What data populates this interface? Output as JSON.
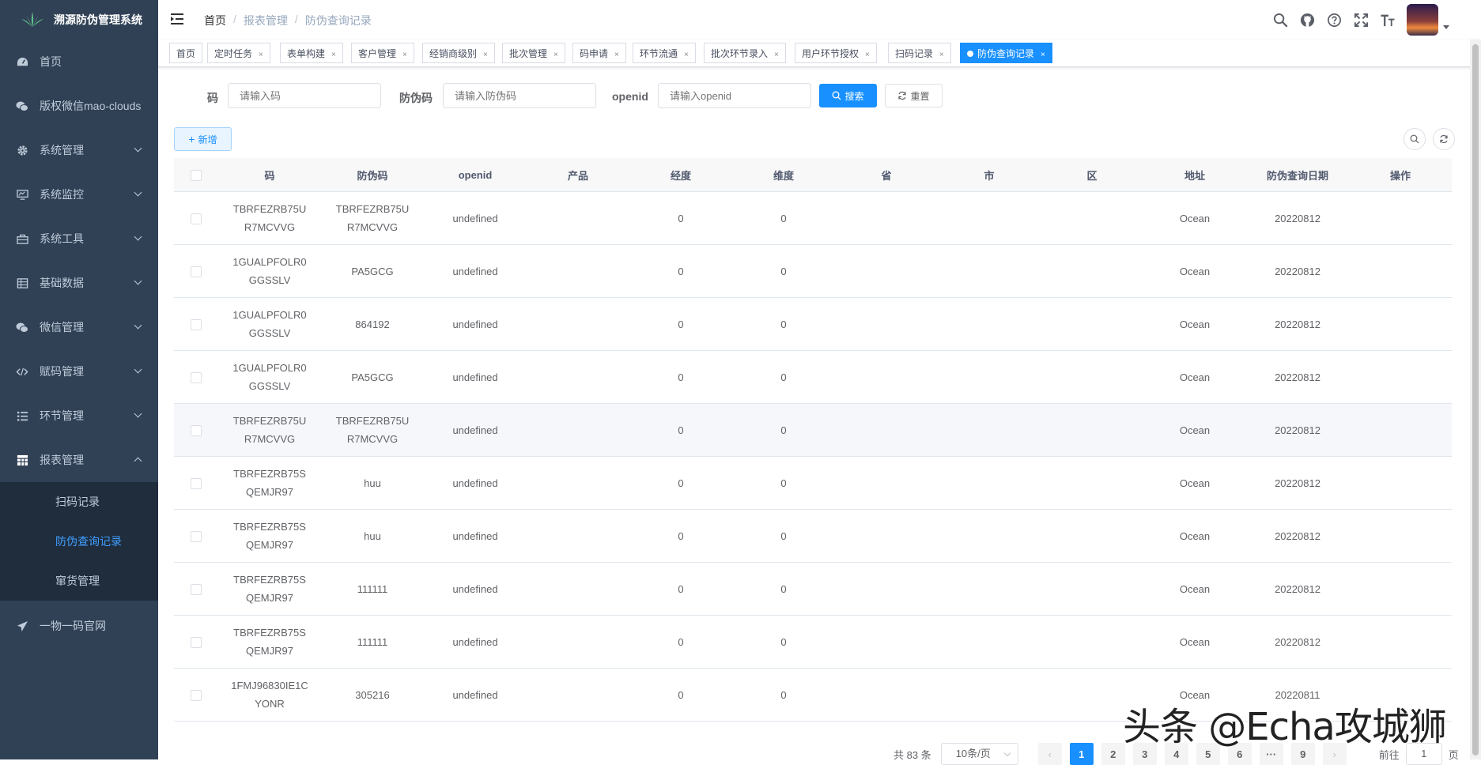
{
  "app": {
    "title": "溯源防伪管理系统"
  },
  "sidebar": {
    "items": [
      {
        "label": "首页",
        "icon": "dashboard-icon",
        "expandable": false
      },
      {
        "label": "版权微信mao-clouds",
        "icon": "wechat-icon",
        "expandable": false
      },
      {
        "label": "系统管理",
        "icon": "gear-icon",
        "expandable": true
      },
      {
        "label": "系统监控",
        "icon": "monitor-icon",
        "expandable": true
      },
      {
        "label": "系统工具",
        "icon": "toolbox-icon",
        "expandable": true
      },
      {
        "label": "基础数据",
        "icon": "table-icon",
        "expandable": true
      },
      {
        "label": "微信管理",
        "icon": "wechat-icon",
        "expandable": true
      },
      {
        "label": "赋码管理",
        "icon": "code-icon",
        "expandable": true
      },
      {
        "label": "环节管理",
        "icon": "list-icon",
        "expandable": true
      },
      {
        "label": "报表管理",
        "icon": "grid-icon",
        "expandable": true,
        "expanded": true
      }
    ],
    "sub_items": [
      {
        "label": "扫码记录",
        "active": false
      },
      {
        "label": "防伪查询记录",
        "active": true
      },
      {
        "label": "窜货管理",
        "active": false
      }
    ],
    "footer_item": {
      "label": "一物一码官网",
      "icon": "send-icon"
    }
  },
  "navbar": {
    "breadcrumb": [
      "首页",
      "报表管理",
      "防伪查询记录"
    ],
    "icons": [
      "search-icon",
      "github-icon",
      "question-icon",
      "fullscreen-icon",
      "font-size-icon"
    ]
  },
  "tags": [
    {
      "label": "首页",
      "closable": false
    },
    {
      "label": "定时任务",
      "closable": true
    },
    {
      "label": "表单构建",
      "closable": true
    },
    {
      "label": "客户管理",
      "closable": true
    },
    {
      "label": "经销商级别",
      "closable": true
    },
    {
      "label": "批次管理",
      "closable": true
    },
    {
      "label": "码申请",
      "closable": true
    },
    {
      "label": "环节流通",
      "closable": true
    },
    {
      "label": "批次环节录入",
      "closable": true
    },
    {
      "label": "用户环节授权",
      "closable": true
    },
    {
      "label": "扫码记录",
      "closable": true
    },
    {
      "label": "防伪查询记录",
      "closable": true,
      "active": true
    }
  ],
  "tag_close_glyph": "×",
  "search_form": {
    "code_label": "码",
    "code_placeholder": "请输入码",
    "anti_label": "防伪码",
    "anti_placeholder": "请输入防伪码",
    "openid_label": "openid",
    "openid_placeholder": "请输入openid",
    "search_button": "搜索",
    "reset_button": "重置"
  },
  "toolbar": {
    "add_button": "新增"
  },
  "table": {
    "columns": [
      "码",
      "防伪码",
      "openid",
      "产品",
      "经度",
      "维度",
      "省",
      "市",
      "区",
      "地址",
      "防伪查询日期",
      "操作"
    ],
    "rows": [
      [
        "TBRFEZRB75UR7MCVVG",
        "TBRFEZRB75UR7MCVVG",
        "undefined",
        "",
        "0",
        "0",
        "",
        "",
        "",
        "Ocean",
        "20220812",
        ""
      ],
      [
        "1GUALPFOLR0GGSSLV",
        "PA5GCG",
        "undefined",
        "",
        "0",
        "0",
        "",
        "",
        "",
        "Ocean",
        "20220812",
        ""
      ],
      [
        "1GUALPFOLR0GGSSLV",
        "864192",
        "undefined",
        "",
        "0",
        "0",
        "",
        "",
        "",
        "Ocean",
        "20220812",
        ""
      ],
      [
        "1GUALPFOLR0GGSSLV",
        "PA5GCG",
        "undefined",
        "",
        "0",
        "0",
        "",
        "",
        "",
        "Ocean",
        "20220812",
        ""
      ],
      [
        "TBRFEZRB75UR7MCVVG",
        "TBRFEZRB75UR7MCVVG",
        "undefined",
        "",
        "0",
        "0",
        "",
        "",
        "",
        "Ocean",
        "20220812",
        ""
      ],
      [
        "TBRFEZRB75SQEMJR97",
        "huu",
        "undefined",
        "",
        "0",
        "0",
        "",
        "",
        "",
        "Ocean",
        "20220812",
        ""
      ],
      [
        "TBRFEZRB75SQEMJR97",
        "huu",
        "undefined",
        "",
        "0",
        "0",
        "",
        "",
        "",
        "Ocean",
        "20220812",
        ""
      ],
      [
        "TBRFEZRB75SQEMJR97",
        "111111",
        "undefined",
        "",
        "0",
        "0",
        "",
        "",
        "",
        "Ocean",
        "20220812",
        ""
      ],
      [
        "TBRFEZRB75SQEMJR97",
        "111111",
        "undefined",
        "",
        "0",
        "0",
        "",
        "",
        "",
        "Ocean",
        "20220812",
        ""
      ],
      [
        "1FMJ96830IE1CYONR",
        "305216",
        "undefined",
        "",
        "0",
        "0",
        "",
        "",
        "",
        "Ocean",
        "20220811",
        ""
      ]
    ]
  },
  "pagination": {
    "total_text": "共 83 条",
    "page_size": "10条/页",
    "pages": [
      "1",
      "2",
      "3",
      "4",
      "5",
      "6",
      "···",
      "9"
    ],
    "current": "1",
    "prev": "‹",
    "next": "›",
    "goto_prefix": "前往",
    "goto_value": "1",
    "goto_suffix": "页"
  },
  "watermark": "头条 @Echa攻城狮",
  "colors": {
    "sidebar_bg": "#304156",
    "submenu_bg": "#1f2d3d",
    "accent": "#1890ff",
    "active_menu": "#409eff"
  }
}
